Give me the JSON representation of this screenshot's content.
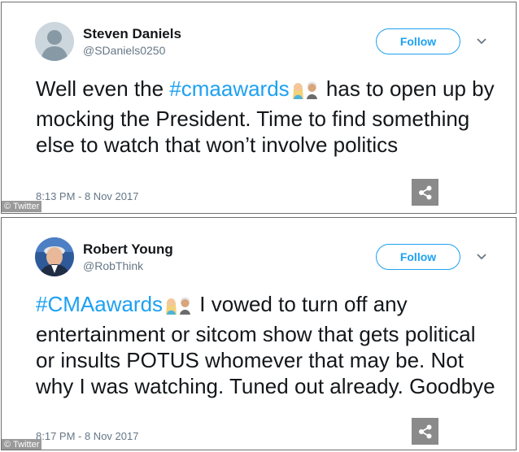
{
  "tweets": [
    {
      "author_name": "Steven Daniels",
      "handle": "@SDaniels0250",
      "follow_label": "Follow",
      "hashtag": "#cmaawards",
      "text_before": "Well even the ",
      "text_after": " has to open up by mocking the President. Time to find something else to watch that won’t involve politics",
      "timestamp": "8:13 PM - 8 Nov 2017",
      "avatar": "default-avatar-icon"
    },
    {
      "author_name": "Robert Young",
      "handle": "@RobThink",
      "follow_label": "Follow",
      "hashtag": "#CMAawards",
      "text_before": "",
      "text_after": " I vowed to turn off any entertainment or sitcom show that gets political or insults POTUS whomever that may be. Not why I was watching. Tuned out already. Goodbye",
      "timestamp": "8:17 PM - 8 Nov 2017",
      "avatar": "photo-avatar"
    }
  ],
  "credit": "© Twitter",
  "colors": {
    "link_blue": "#1da1f2",
    "muted_gray": "#657786",
    "share_gray": "#8a8a8a"
  }
}
